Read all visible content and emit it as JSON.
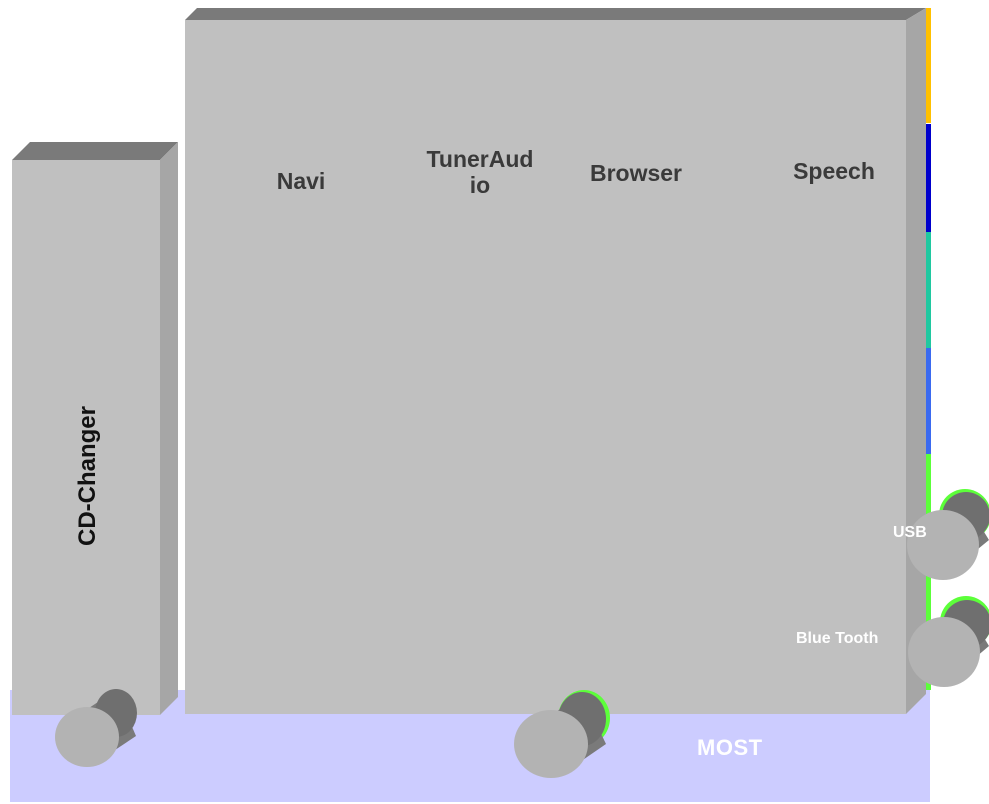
{
  "diagram": {
    "bus": {
      "label": "MOST",
      "color": "#ccccff"
    },
    "changer": {
      "label": "CD-Changer"
    },
    "modules": [
      {
        "label": "Navi"
      },
      {
        "label": "TunerAud\nio"
      },
      {
        "label": "Browser"
      },
      {
        "label": "Speech"
      }
    ],
    "connectors": [
      {
        "label": "USB"
      },
      {
        "label": "Blue Tooth"
      }
    ],
    "colors": {
      "box_face": "#c0c0c0",
      "box_top": "#7a7a7a",
      "box_side": "#a6a6a6",
      "connector_glow": "#5cff3a",
      "side_strips": [
        "#ffc000",
        "#0000cc",
        "#20c8a0",
        "#3a6af0",
        "#5cff3a"
      ]
    }
  }
}
